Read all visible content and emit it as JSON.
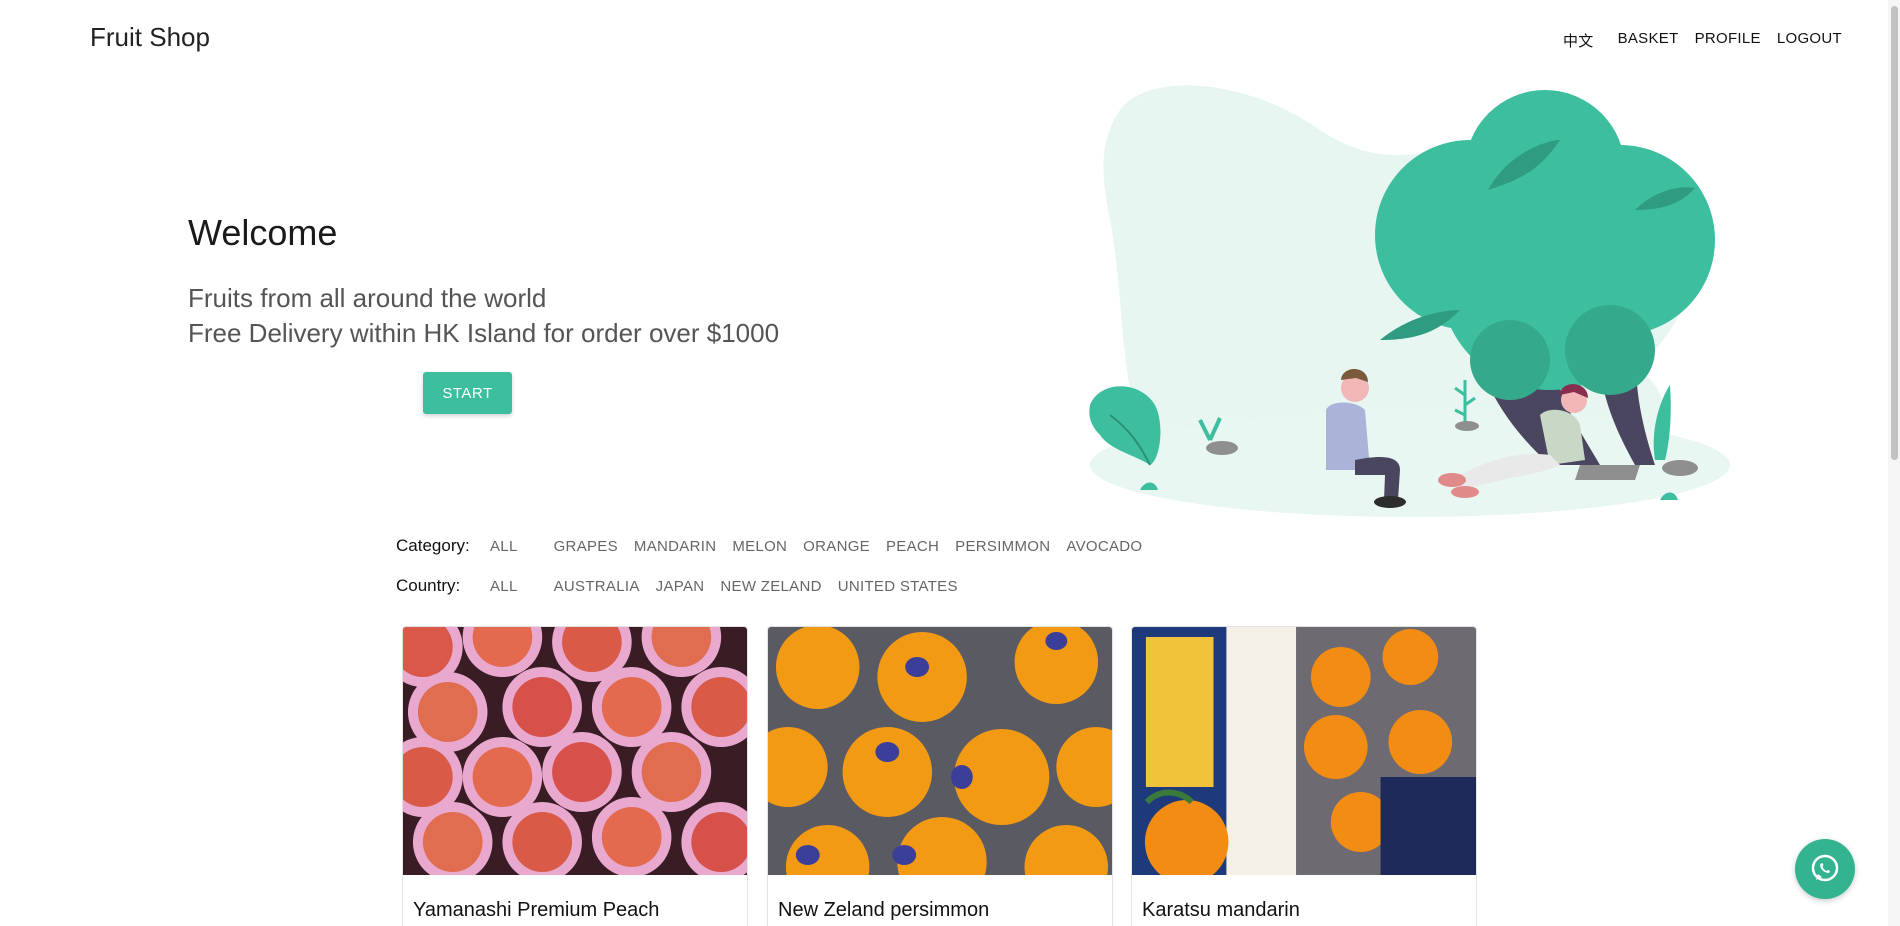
{
  "header": {
    "brand": "Fruit Shop",
    "nav": {
      "lang": "中文",
      "basket": "BASKET",
      "profile": "PROFILE",
      "logout": "LOGOUT"
    }
  },
  "hero": {
    "title": "Welcome",
    "tagline1": "Fruits from all around the world",
    "tagline2": "Free Delivery within HK Island for order over $1000",
    "start_label": "START"
  },
  "filters": {
    "category_label": "Category:",
    "categories": [
      "ALL",
      "GRAPES",
      "MANDARIN",
      "MELON",
      "ORANGE",
      "PEACH",
      "PERSIMMON",
      "AVOCADO"
    ],
    "country_label": "Country:",
    "countries": [
      "ALL",
      "AUSTRALIA",
      "JAPAN",
      "NEW ZELAND",
      "UNITED STATES"
    ]
  },
  "products": [
    {
      "name": "Yamanashi Premium Peach",
      "icon": "peach-photo"
    },
    {
      "name": "New Zeland persimmon",
      "icon": "persimmon-photo"
    },
    {
      "name": "Karatsu mandarin",
      "icon": "mandarin-box-photo"
    }
  ],
  "colors": {
    "accent": "#3dbf9f",
    "whatsapp": "#34b390"
  },
  "icons": {
    "chat": "whatsapp-icon"
  }
}
